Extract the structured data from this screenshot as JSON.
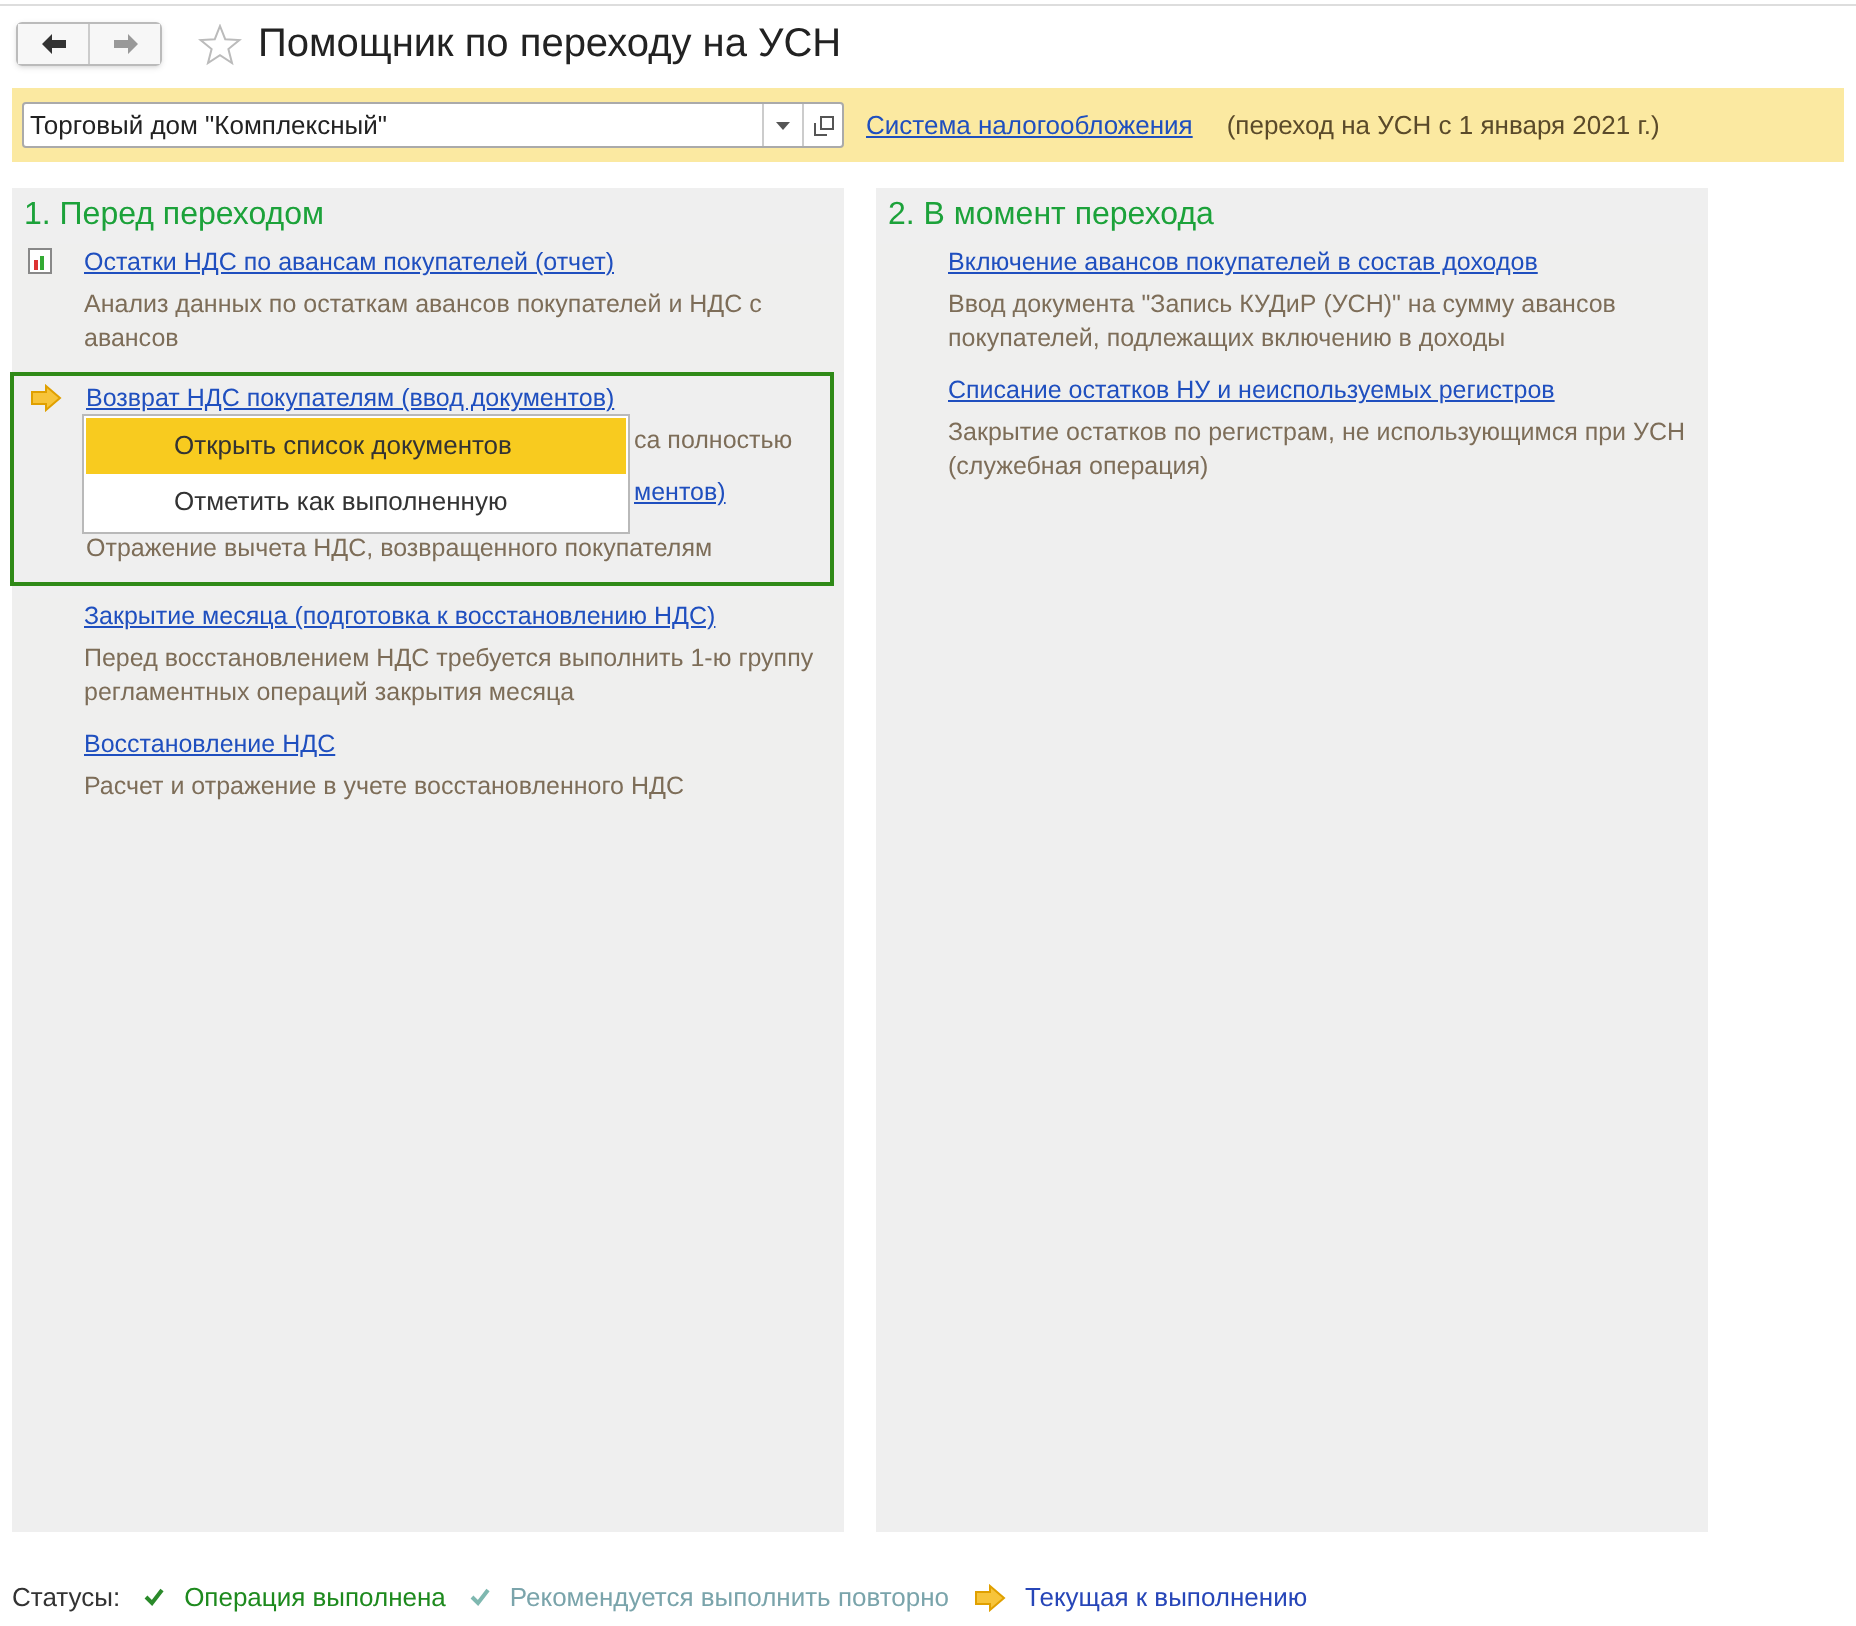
{
  "window": {
    "title": "Помощник по переходу на УСН"
  },
  "organization": {
    "value": "Торговый дом \"Комплексный\""
  },
  "tax_link": "Система налогообложения",
  "transition_note": "(переход на УСН с 1 января 2021 г.)",
  "sections": [
    {
      "title": "1. Перед переходом",
      "steps": [
        {
          "kind": "report",
          "link": "Остатки НДС по авансам покупателей (отчет)",
          "description": "Анализ данных по остаткам авансов покупателей и НДС с авансов",
          "highlighted": false
        },
        {
          "kind": "current",
          "link": "Возврат НДС покупателям (ввод документов)",
          "description": "са полностью",
          "highlighted": true,
          "covered": true
        },
        {
          "kind": "none",
          "link": "ментов)",
          "description": "Отражение вычета НДС, возвращенного покупателям",
          "highlighted": true,
          "covered": true
        },
        {
          "kind": "none",
          "link": "Закрытие месяца (подготовка к восстановлению НДС)",
          "description": "Перед восстановлением НДС требуется выполнить 1-ю группу регламентных операций закрытия месяца",
          "highlighted": false
        },
        {
          "kind": "none",
          "link": "Восстановление НДС",
          "description": "Расчет и отражение в учете восстановленного НДС",
          "highlighted": false
        }
      ]
    },
    {
      "title": "2. В момент перехода",
      "steps": [
        {
          "kind": "none",
          "link": "Включение авансов покупателей в состав доходов",
          "description": "Ввод документа \"Запись КУДиР (УСН)\" на сумму авансов покупателей, подлежащих включению в доходы",
          "highlighted": false
        },
        {
          "kind": "none",
          "link": "Списание остатков НУ и неиспользуемых регистров",
          "description": "Закрытие остатков по  регистрам, не использующимся при УСН (служебная операция)",
          "highlighted": false
        }
      ]
    }
  ],
  "context_menu": {
    "items": [
      {
        "label": "Открыть список документов",
        "selected": true
      },
      {
        "label": "Отметить как выполненную",
        "selected": false
      }
    ]
  },
  "legend": {
    "label": "Статусы:",
    "items": [
      {
        "kind": "done",
        "label": "Операция выполнена"
      },
      {
        "kind": "repeat",
        "label": "Рекомендуется выполнить повторно"
      },
      {
        "kind": "current",
        "label": "Текущая к выполнению"
      }
    ]
  }
}
